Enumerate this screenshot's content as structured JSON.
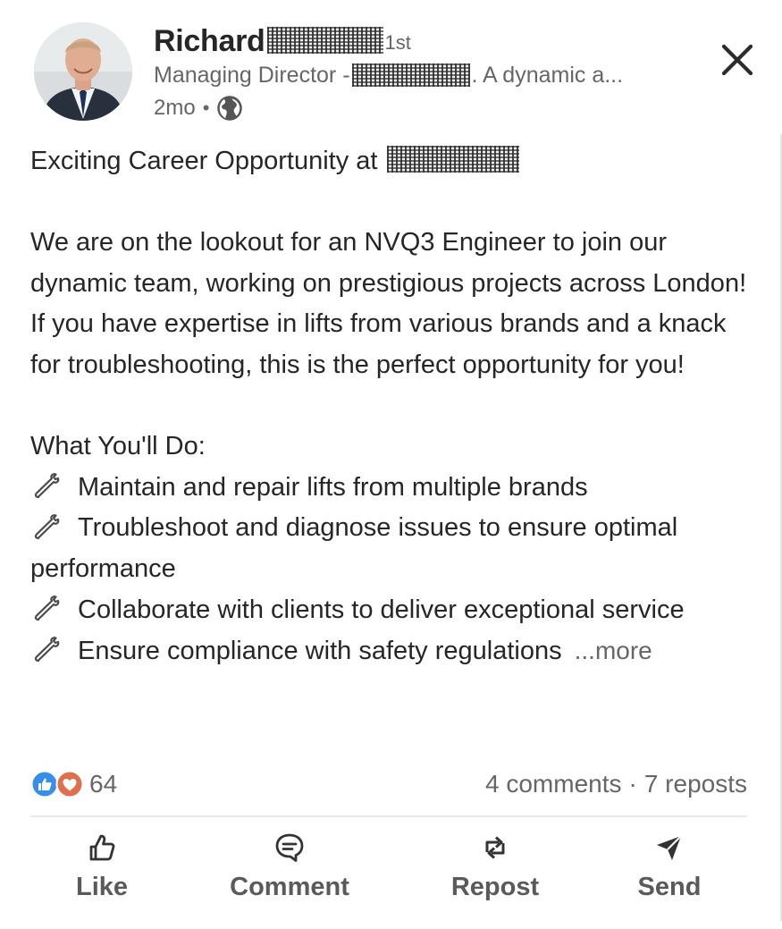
{
  "post": {
    "author": {
      "name": "Richard",
      "degree": "1st",
      "headline_prefix": "Managing Director -",
      "headline_suffix": ". A dynamic a...",
      "time_ago": "2mo",
      "meta_separator": "•",
      "visibility_icon": "globe-icon"
    },
    "body": {
      "intro": "Exciting Career Opportunity at",
      "paragraph": "We are on the lookout for an NVQ3 Engineer to join our dynamic team, working on prestigious projects across London! If you have expertise in lifts from various brands and a knack for troubleshooting, this is the perfect opportunity for you!",
      "section_title": "What You'll Do:",
      "bullets": [
        "Maintain and repair lifts from multiple brands",
        "Troubleshoot and diagnose issues to ensure optimal performance",
        "Collaborate with clients to deliver exceptional service",
        "Ensure compliance with safety regulations"
      ],
      "bullet_icon": "wrench-icon",
      "more_label": "...more"
    },
    "social": {
      "reaction_count": "64",
      "comments": "4 comments",
      "separator": "·",
      "reposts": "7 reposts"
    },
    "actions": {
      "like": "Like",
      "comment": "Comment",
      "repost": "Repost",
      "send": "Send"
    }
  },
  "colors": {
    "like_blue": "#378fe9",
    "love_red": "#df704d",
    "muted_text": "#666666",
    "body_text": "#262626"
  }
}
